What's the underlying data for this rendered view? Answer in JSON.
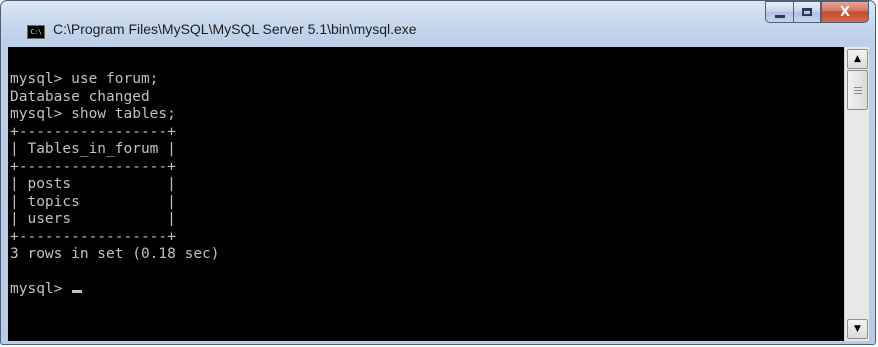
{
  "window": {
    "title": "C:\\Program Files\\MySQL\\MySQL Server 5.1\\bin\\mysql.exe",
    "icon": "console-app-icon",
    "icon_label": "C:\\",
    "controls": {
      "minimize": "minimize-icon",
      "maximize": "maximize-icon",
      "close": "close-icon",
      "close_glyph": "X"
    }
  },
  "console": {
    "lines": [
      "mysql> use forum;",
      "Database changed",
      "mysql> show tables;",
      "+-----------------+",
      "| Tables_in_forum |",
      "+-----------------+",
      "| posts           |",
      "| topics          |",
      "| users           |",
      "+-----------------+",
      "3 rows in set (0.18 sec)",
      "",
      "mysql> "
    ],
    "background": "#000000",
    "foreground": "#c0c0c0"
  },
  "scrollbar": {
    "up_icon": "scroll-up-arrow-icon",
    "down_icon": "scroll-down-arrow-icon",
    "up_glyph": "▲",
    "down_glyph": "▼"
  }
}
